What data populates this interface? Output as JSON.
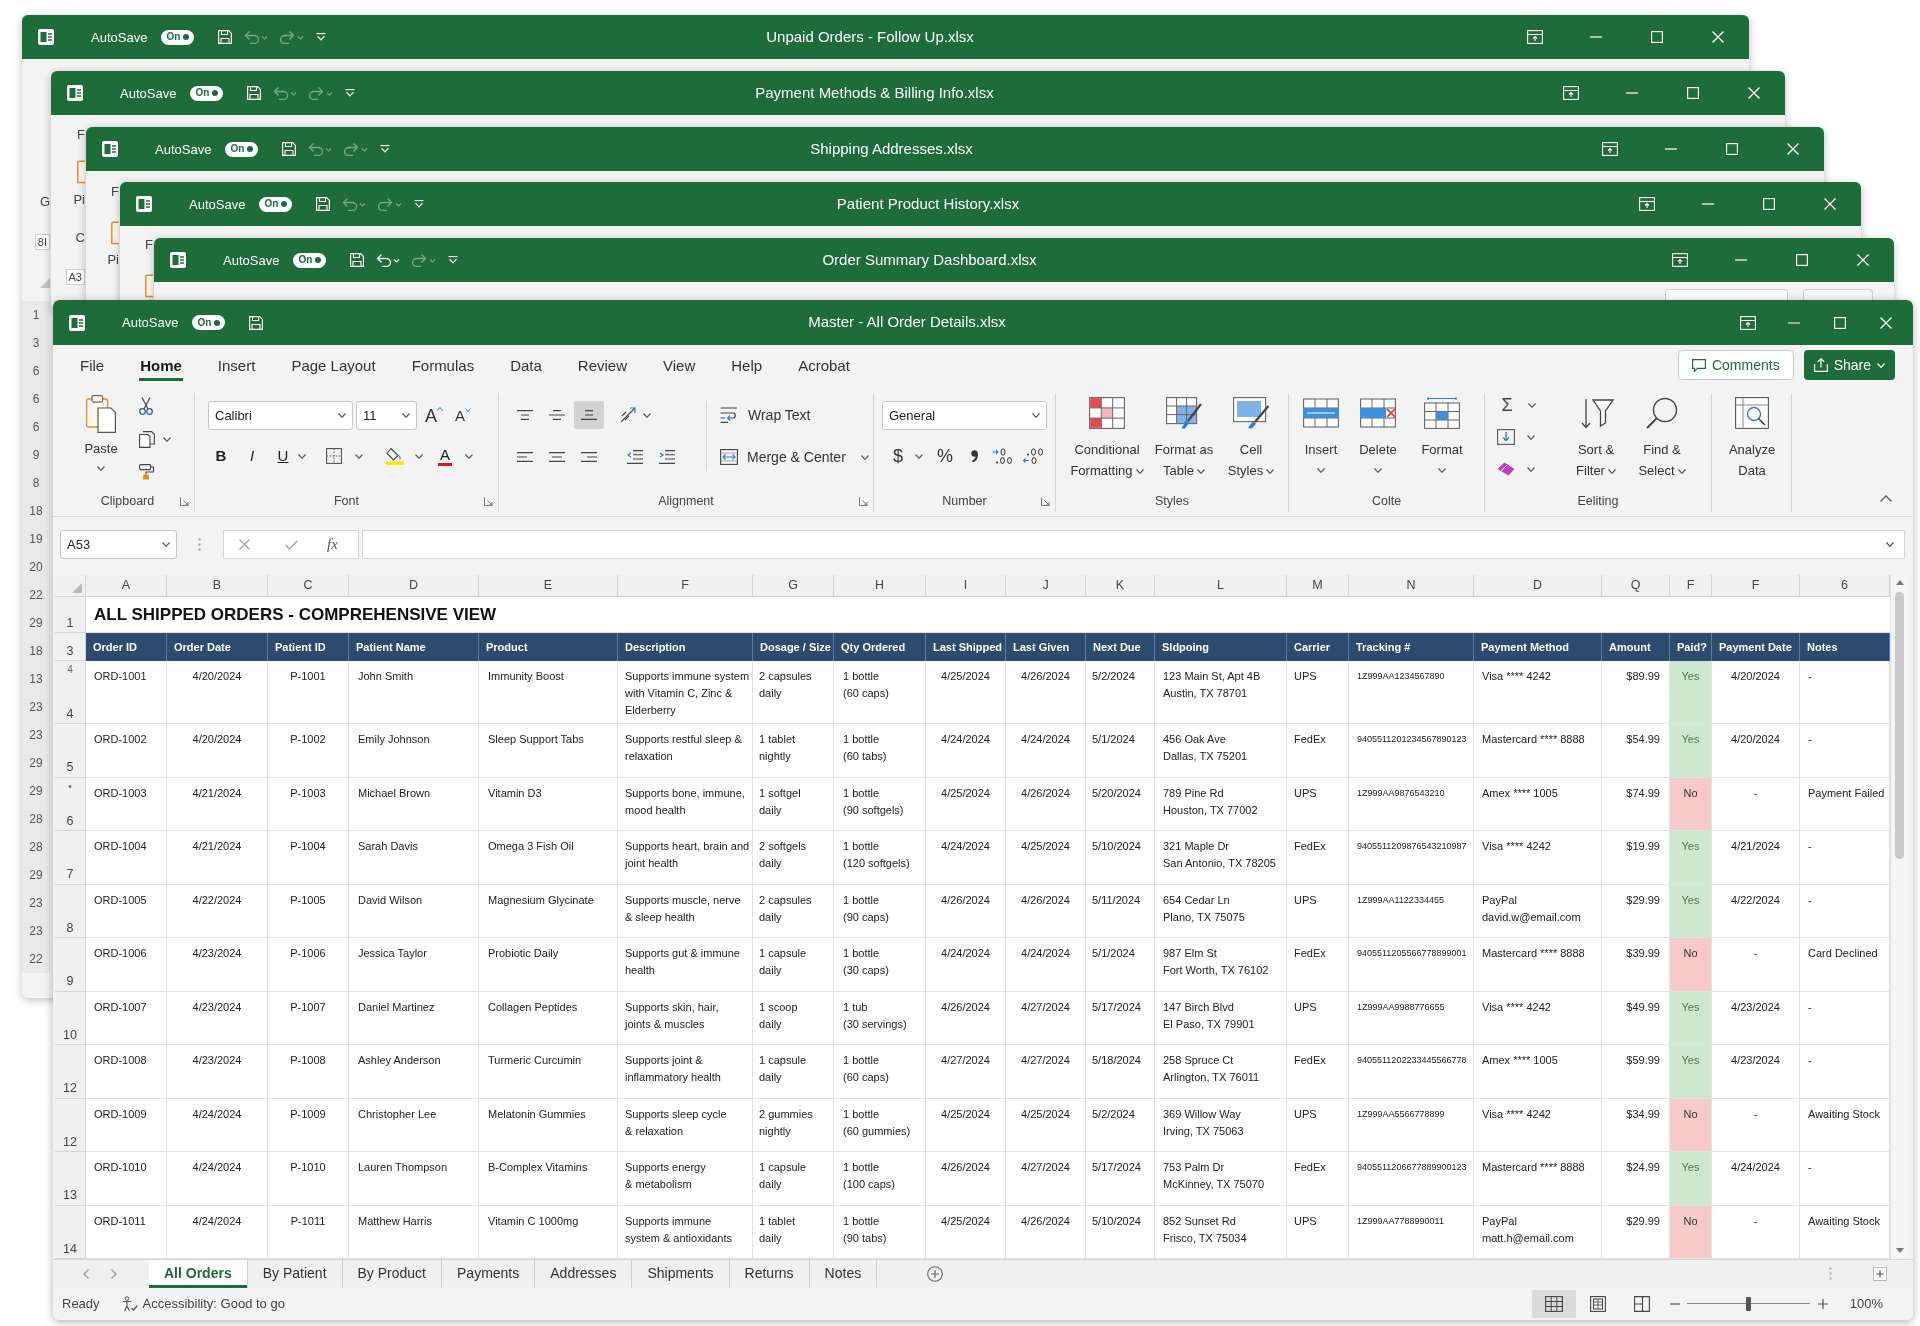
{
  "background_windows": [
    {
      "title": "Unpaid Orders - Follow Up.xlsx",
      "autosave": {
        "label": "AutoSave",
        "state": "On",
        "on": true
      },
      "quick_access": [
        {
          "kind": "save",
          "disabled": false
        },
        {
          "kind": "undo",
          "disabled": true
        },
        {
          "kind": "redo",
          "disabled": true
        },
        {
          "kind": "customize",
          "disabled": false
        }
      ],
      "edge": [
        {
          "kind": "text",
          "text": "G"
        },
        {
          "kind": "box",
          "text": "8I"
        },
        {
          "kind": "corner"
        }
      ],
      "row_numbers": [
        "1",
        "3",
        "6",
        "6",
        "6",
        "9",
        "8",
        "18",
        "19",
        "20",
        "22",
        "29",
        "18",
        "13",
        "23",
        "23",
        "29",
        "29",
        "28",
        "28",
        "29",
        "23",
        "23",
        "22"
      ]
    },
    {
      "title": "Payment Methods & Billing Info.xlsx",
      "autosave": {
        "label": "AutoSave",
        "state": "On",
        "on": true
      },
      "quick_access": [
        {
          "kind": "save",
          "disabled": false
        },
        {
          "kind": "undo",
          "disabled": true
        },
        {
          "kind": "redo",
          "disabled": true
        },
        {
          "kind": "customize",
          "disabled": false
        }
      ],
      "edge": [
        {
          "kind": "text",
          "text": "F"
        },
        {
          "kind": "paste-icon"
        },
        {
          "kind": "text",
          "text": "Pi"
        },
        {
          "kind": "text",
          "text": "C"
        },
        {
          "kind": "box",
          "text": "A3"
        }
      ]
    },
    {
      "title": "Shipping Addresses.xlsx",
      "autosave": {
        "label": "AutoSave",
        "state": "On",
        "on": true
      },
      "quick_access": [
        {
          "kind": "save",
          "disabled": false
        },
        {
          "kind": "undo",
          "disabled": true
        },
        {
          "kind": "redo",
          "disabled": true
        },
        {
          "kind": "customize",
          "disabled": false
        }
      ],
      "edge": [
        {
          "kind": "text",
          "text": "F"
        },
        {
          "kind": "paste-icon"
        },
        {
          "kind": "text",
          "text": "Pi"
        }
      ]
    },
    {
      "title": "Patient Product History.xlsx",
      "autosave": {
        "label": "AutoSave",
        "state": "On",
        "on": true
      },
      "quick_access": [
        {
          "kind": "save",
          "disabled": false
        },
        {
          "kind": "undo",
          "disabled": true
        },
        {
          "kind": "redo",
          "disabled": true
        },
        {
          "kind": "customize",
          "disabled": false
        }
      ],
      "edge": [
        {
          "kind": "text",
          "text": "F"
        },
        {
          "kind": "paste-icon"
        }
      ]
    },
    {
      "title": "Order Summary Dashboard.xlsx",
      "autosave": {
        "label": "AutoSave",
        "state": "On",
        "on": true
      },
      "quick_access": [
        {
          "kind": "save",
          "disabled": false
        },
        {
          "kind": "undo",
          "disabled": false
        },
        {
          "kind": "redo",
          "disabled": true
        },
        {
          "kind": "customize",
          "disabled": false
        }
      ],
      "cut_off_buttons": [
        {
          "kind": "comments"
        },
        {
          "kind": "share"
        }
      ]
    }
  ],
  "window": {
    "title": "Master - All Order Details.xlsx",
    "autosave": {
      "label": "AutoSave",
      "state": "On",
      "on": true
    },
    "quick_access": [
      {
        "kind": "save",
        "disabled": false
      }
    ],
    "ribbon_tabs": [
      {
        "label": "File",
        "selected": false
      },
      {
        "label": "Home",
        "selected": true
      },
      {
        "label": "Insert",
        "selected": false
      },
      {
        "label": "Page Layout",
        "selected": false
      },
      {
        "label": "Formulas",
        "selected": false
      },
      {
        "label": "Data",
        "selected": false
      },
      {
        "label": "Review",
        "selected": false
      },
      {
        "label": "View",
        "selected": false
      },
      {
        "label": "Help",
        "selected": false
      },
      {
        "label": "Acrobat",
        "selected": false
      }
    ],
    "comments": "Comments",
    "share": "Share",
    "ribbon": {
      "clipboard": {
        "label": "Clipboard",
        "launcher": true,
        "paste": "Paste"
      },
      "font": {
        "label": "Font",
        "launcher": true,
        "font_name": "Calibri",
        "font_size": "11",
        "grow": "A",
        "shrink": "A",
        "bold": "B",
        "italic": "I",
        "underline": "U",
        "font_color": "A"
      },
      "alignment": {
        "label": "Alignment",
        "launcher": true,
        "vertical": [
          {
            "kind": "top",
            "selected": false
          },
          {
            "kind": "middle",
            "selected": false
          },
          {
            "kind": "bottom",
            "selected": true
          }
        ],
        "horizontal": [
          {
            "kind": "left",
            "selected": false
          },
          {
            "kind": "center",
            "selected": false
          },
          {
            "kind": "right",
            "selected": false
          }
        ],
        "wrap_text": "Wrap Text",
        "merge": "Merge & Center"
      },
      "number": {
        "label": "Number",
        "launcher": true,
        "format": "General",
        "currency": "$",
        "percent": "%"
      },
      "styles": {
        "label": "Styles",
        "buttons": [
          {
            "kind": "conditional-formatting",
            "label": "Conditional\nFormatting"
          },
          {
            "kind": "format-as-table",
            "label": "Format as\nTable"
          },
          {
            "kind": "cell-styles",
            "label": "Cell\nStyles"
          }
        ]
      },
      "cells": {
        "label": "Colte",
        "buttons": [
          {
            "kind": "insert",
            "label": "Insert"
          },
          {
            "kind": "delete",
            "label": "Delete"
          },
          {
            "kind": "format",
            "label": "Format"
          }
        ]
      },
      "editing": {
        "label": "Eeliting",
        "autosum": "Σ",
        "buttons": [
          {
            "kind": "sort-filter",
            "label": "Sort &\nFilter"
          },
          {
            "kind": "find-select",
            "label": "Find &\nSelect"
          }
        ]
      },
      "analysis": {
        "buttons": [
          {
            "kind": "analyze-data",
            "label": "Analyze\nData"
          }
        ]
      }
    },
    "formula_bar": {
      "name_box": "A53",
      "fx": "fx"
    },
    "sheet": {
      "column_letters": [
        "A",
        "B",
        "C",
        "D",
        "E",
        "F",
        "G",
        "H",
        "I",
        "J",
        "K",
        "L",
        "M",
        "N",
        "D",
        "Q",
        "F",
        "F",
        "6"
      ],
      "title_row": {
        "row_number": "1",
        "title": "ALL SHIPPED ORDERS - COMPREHENSIVE VIEW"
      },
      "header_row_number": "3",
      "columns": [
        "Order ID",
        "Order Date",
        "Patient ID",
        "Patient Name",
        "Product",
        "Description",
        "Dosage / Size",
        "Qty Ordered",
        "Last Shipped",
        "Last Given",
        "Next Due",
        "Sldpoing",
        "Carrier",
        "Tracking #",
        "Payment Method",
        "Amount",
        "Paid?",
        "Payment Date",
        "Notes"
      ],
      "rows": [
        {
          "row_number": "4",
          "row_mark": "4",
          "paid": true,
          "cells": [
            "ORD-1001",
            "4/20/2024",
            "P-1001",
            "John Smith",
            "Immunity Boost",
            "Supports immune system\nwith Vitamin C, Zinc &\nElderberry",
            "2 capsules\ndaily",
            "1 bottle\n(60 caps)",
            "4/25/2024",
            "4/26/2024",
            "5/2/2024",
            "123 Main St, Apt 4B\nAustin, TX 78701",
            "UPS",
            "1Z999AA1234567890",
            "Visa **** 4242",
            "$89.99",
            "Yes",
            "4/20/2024",
            "-"
          ]
        },
        {
          "row_number": "5",
          "paid": true,
          "cells": [
            "ORD-1002",
            "4/20/2024",
            "P-1002",
            "Emily Johnson",
            "Sleep Support Tabs",
            "Supports restful sleep &\nrelaxation",
            "1 tablet\nnightly",
            "1 bottle\n(60 tabs)",
            "4/24/2024",
            "4/24/2024",
            "5/1/2024",
            "456 Oak Ave\nDallas, TX 75201",
            "FedEx",
            "9405511201234567890123",
            "Mastercard **** 8888",
            "$54.99",
            "Yes",
            "4/20/2024",
            "-"
          ]
        },
        {
          "row_number": "6",
          "row_mark": "•",
          "paid": false,
          "cells": [
            "ORD-1003",
            "4/21/2024",
            "P-1003",
            "Michael Brown",
            "Vitamin D3",
            "Supports bone, immune,\nmood health",
            "1 softgel\ndaily",
            "1 bottle\n(90 softgels)",
            "4/25/2024",
            "4/26/2024",
            "5/20/2024",
            "789 Pine Rd\nHouston, TX 77002",
            "UPS",
            "1Z999AA9876543210",
            "Amex **** 1005",
            "$74.99",
            "No",
            "-",
            "Payment Failed"
          ]
        },
        {
          "row_number": "7",
          "paid": true,
          "cells": [
            "ORD-1004",
            "4/21/2024",
            "P-1004",
            "Sarah Davis",
            "Omega 3 Fish Oil",
            "Supports heart, brain and\njoint health",
            "2 softgels\ndaily",
            "1 bottle\n(120 softgels)",
            "4/24/2024",
            "4/25/2024",
            "5/10/2024",
            "321 Maple Dr\nSan Antonio, TX 78205",
            "FedEx",
            "9405511209876543210987",
            "Visa **** 4242",
            "$19.99",
            "Yes",
            "4/21/2024",
            "-"
          ]
        },
        {
          "row_number": "8",
          "paid": true,
          "cells": [
            "ORD-1005",
            "4/22/2024",
            "P-1005",
            "David Wilson",
            "Magnesium Glycinate",
            "Supports muscle, nerve\n& sleep health",
            "2 capsules\ndaily",
            "1 bottle\n(90 caps)",
            "4/26/2024",
            "4/26/2024",
            "5/11/2024",
            "654 Cedar Ln\nPlano, TX 75075",
            "UPS",
            "1Z999AA1122334455",
            "PayPal\ndavid.w@email.com",
            "$29.99",
            "Yes",
            "4/22/2024",
            "-"
          ]
        },
        {
          "row_number": "9",
          "paid": false,
          "cells": [
            "ORD-1006",
            "4/23/2024",
            "P-1006",
            "Jessica Taylor",
            "Probiotic Daily",
            "Supports gut & immune\nhealth",
            "1 capsule\ndaily",
            "1 bottle\n(30 caps)",
            "4/24/2024",
            "4/24/2024",
            "5/1/2024",
            "987 Elm St\nFort Worth, TX 76102",
            "FedEx",
            "9405511205566778899001",
            "Mastercard **** 8888",
            "$39.99",
            "No",
            "-",
            "Card Declined"
          ]
        },
        {
          "row_number": "10",
          "paid": true,
          "cells": [
            "ORD-1007",
            "4/23/2024",
            "P-1007",
            "Daniel Martinez",
            "Collagen Peptides",
            "Supports skin, hair,\njoints & muscles",
            "1 scoop\ndaily",
            "1 tub\n(30 servings)",
            "4/26/2024",
            "4/27/2024",
            "5/17/2024",
            "147 Birch Blvd\nEl Paso, TX 79901",
            "UPS",
            "1Z999AA9988776655",
            "Visa **** 4242",
            "$49.99",
            "Yes",
            "4/23/2024",
            "-"
          ]
        },
        {
          "row_number": "12",
          "paid": true,
          "cells": [
            "ORD-1008",
            "4/23/2024",
            "P-1008",
            "Ashley Anderson",
            "Turmeric Curcumin",
            "Supports joint &\ninflammatory health",
            "1 capsule\ndaily",
            "1 bottle\n(60 caps)",
            "4/27/2024",
            "4/27/2024",
            "5/18/2024",
            "258 Spruce Ct\nArlington, TX 76011",
            "FedEx",
            "9405511202233445566778",
            "Amex **** 1005",
            "$59.99",
            "Yes",
            "4/23/2024",
            "-"
          ]
        },
        {
          "row_number": "12",
          "paid": false,
          "cells": [
            "ORD-1009",
            "4/24/2024",
            "P-1009",
            "Christopher Lee",
            "Melatonin Gummies",
            "Supports sleep cycle\n& relaxation",
            "2 gummies\nnightly",
            "1 bottle\n(60 gummies)",
            "4/25/2024",
            "4/25/2024",
            "5/2/2024",
            "369 Willow Way\nIrving, TX 75063",
            "UPS",
            "1Z999AA5566778899",
            "Visa **** 4242",
            "$34.99",
            "No",
            "-",
            "Awaiting Stock"
          ]
        },
        {
          "row_number": "13",
          "paid": true,
          "cells": [
            "ORD-1010",
            "4/24/2024",
            "P-1010",
            "Lauren Thompson",
            "B-Complex Vitamins",
            "Supports energy\n& metabolism",
            "1 capsule\ndaily",
            "1 bottle\n(100 caps)",
            "4/26/2024",
            "4/27/2024",
            "5/17/2024",
            "753 Palm Dr\nMcKinney, TX 75070",
            "FedEx",
            "9405511206677889900123",
            "Mastercard **** 8888",
            "$24.99",
            "Yes",
            "4/24/2024",
            "-"
          ]
        },
        {
          "row_number": "14",
          "paid": false,
          "cells": [
            "ORD-1011",
            "4/24/2024",
            "P-1011",
            "Matthew Harris",
            "Vitamin C 1000mg",
            "Supports immune\nsystem & antioxidants",
            "1 tablet\ndaily",
            "1 bottle\n(90 tabs)",
            "4/25/2024",
            "4/26/2024",
            "5/10/2024",
            "852 Sunset Rd\nFrisco, TX 75034",
            "UPS",
            "1Z999AA7788990011",
            "PayPal\nmatt.h@email.com",
            "$29.99",
            "No",
            "-",
            "Awaiting Stock"
          ]
        }
      ]
    },
    "sheet_tabs": [
      {
        "label": "All Orders",
        "selected": true
      },
      {
        "label": "By Patient",
        "selected": false
      },
      {
        "label": "By Product",
        "selected": false
      },
      {
        "label": "Payments",
        "selected": false
      },
      {
        "label": "Addresses",
        "selected": false
      },
      {
        "label": "Shipments",
        "selected": false
      },
      {
        "label": "Returns",
        "selected": false
      },
      {
        "label": "Notes",
        "selected": false
      }
    ],
    "status_bar": {
      "ready": "Ready",
      "accessibility": "Accessibility: Good to go",
      "views": [
        {
          "kind": "normal",
          "selected": true
        },
        {
          "kind": "page-layout",
          "selected": false
        },
        {
          "kind": "page-break",
          "selected": false
        }
      ],
      "zoom": {
        "level": 0.5,
        "label": "100%"
      }
    }
  }
}
